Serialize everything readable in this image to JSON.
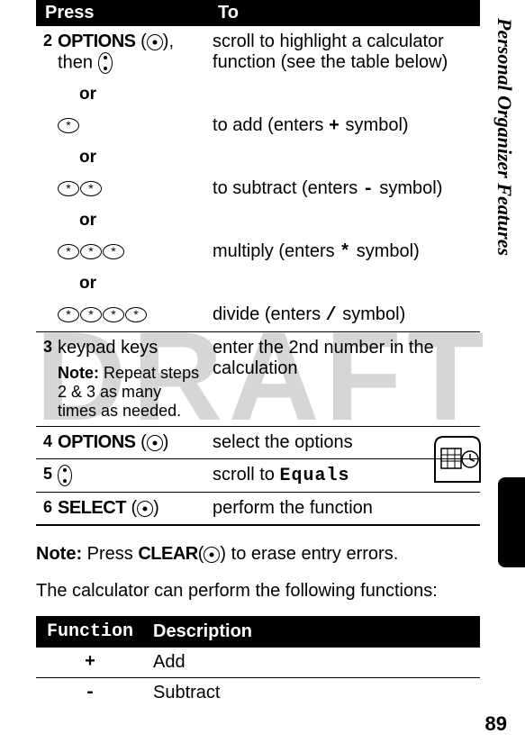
{
  "watermark": "DRAFT",
  "sidebar_title": "Personal Organizer Features",
  "page_number": "89",
  "headers": {
    "press": "Press",
    "to": "To"
  },
  "rows": {
    "r2": {
      "num": "2",
      "press_main": "OPTIONS",
      "press_then": ", then ",
      "to_main": "scroll to highlight a calculator function (see the table below)",
      "or": "or",
      "add_to": "to add (enters ",
      "add_sym": "+",
      "add_end": " symbol)",
      "sub_to": "to subtract (enters ",
      "sub_sym": "-",
      "sub_end": " symbol)",
      "mul_to": "multiply (enters ",
      "mul_sym": "*",
      "mul_end": " symbol)",
      "div_to": "divide (enters ",
      "div_sym": "/",
      "div_end": " symbol)"
    },
    "r3": {
      "num": "3",
      "press": "keypad keys",
      "note_label": "Note:",
      "note": " Repeat steps 2 & 3 as many times as needed.",
      "to": "enter the 2nd number in the calculation"
    },
    "r4": {
      "num": "4",
      "press": "OPTIONS",
      "to": "select the options"
    },
    "r5": {
      "num": "5",
      "to_a": "scroll to ",
      "to_b": "Equals"
    },
    "r6": {
      "num": "6",
      "press": "SELECT",
      "to": "perform the function"
    }
  },
  "note": {
    "label": "Note:",
    "a": " Press ",
    "cmd": "CLEAR",
    "b": " to erase entry errors."
  },
  "calc_intro": "The calculator can perform the following functions:",
  "func_headers": {
    "function": "Function",
    "description": "Description"
  },
  "funcs": {
    "add": {
      "sym": "+",
      "desc": "Add"
    },
    "sub": {
      "sym": "-",
      "desc": "Subtract"
    }
  },
  "star": "*"
}
